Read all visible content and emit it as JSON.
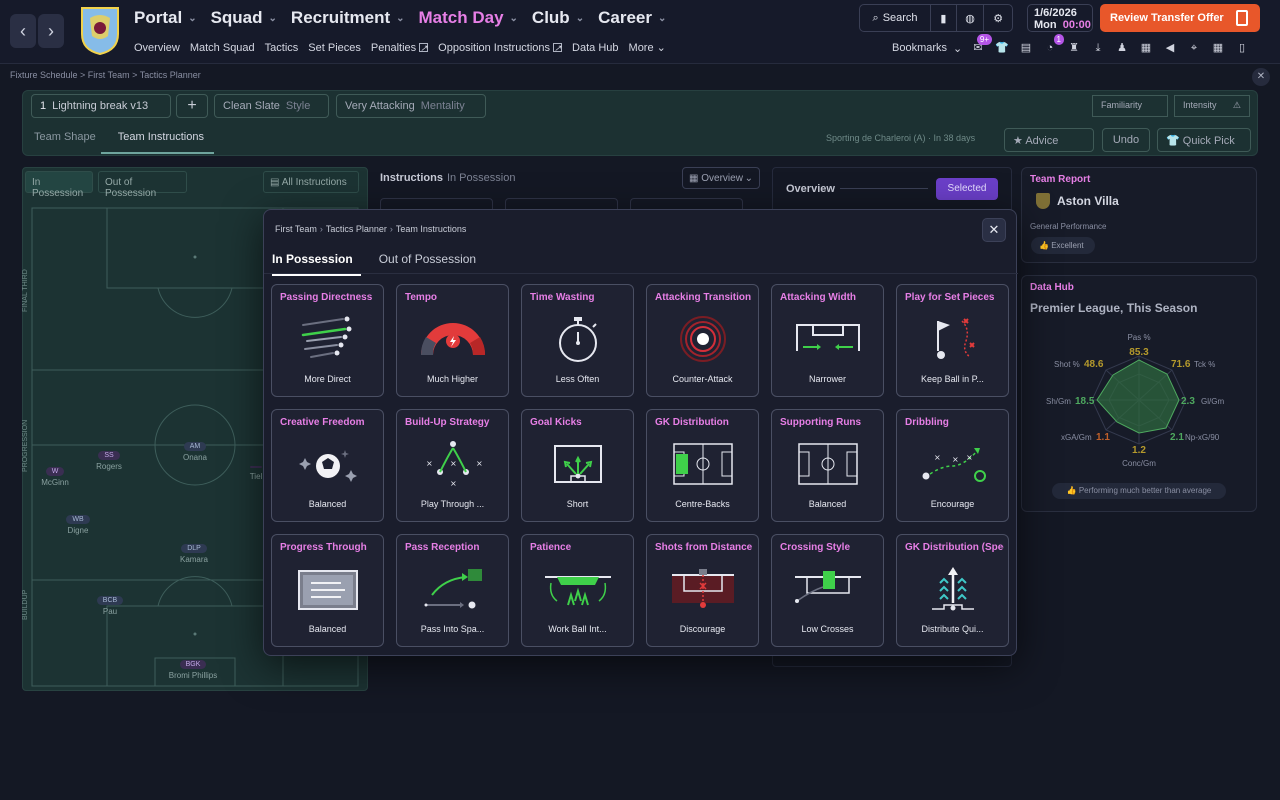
{
  "header": {
    "main_menu": [
      {
        "label": "Portal",
        "active": false
      },
      {
        "label": "Squad",
        "active": false
      },
      {
        "label": "Recruitment",
        "active": false
      },
      {
        "label": "Match Day",
        "active": true
      },
      {
        "label": "Club",
        "active": false
      },
      {
        "label": "Career",
        "active": false
      }
    ],
    "sub_menu": [
      "Overview",
      "Match Squad",
      "Tactics",
      "Set Pieces",
      "Penalties",
      "Opposition Instructions",
      "Data Hub",
      "More"
    ],
    "search_label": "Search",
    "date": "1/6/2026",
    "day": "Mon",
    "time": "00:00",
    "transfer_label": "Review Transfer Offer",
    "bookmarks_label": "Bookmarks",
    "badges": {
      "first": "9+",
      "second": "1"
    },
    "accent": "#e77fe6",
    "transfer_color": "#e8572a"
  },
  "breadcrumb": "Fixture Schedule  >  First Team  >  Tactics Planner",
  "planner": {
    "tactic_name": "Lightning break v13",
    "tactic_number": "1",
    "style": {
      "value": "Clean Slate",
      "label": "Style"
    },
    "mentality": {
      "value": "Very Attacking",
      "label": "Mentality"
    },
    "familiarity_label": "Familiarity",
    "intensity_label": "Intensity",
    "tabs": [
      "Team Shape",
      "Team Instructions"
    ],
    "fixture_note": "Sporting de Charleroi (A)  ·  In 38 days",
    "advice_label": "Advice",
    "undo_label": "Undo",
    "quick_pick_label": "Quick Pick"
  },
  "pitch": {
    "tab_in": "In Possession",
    "tab_out": "Out of Possession",
    "all_instructions": "All Instructions",
    "zones": [
      "FINAL THIRD",
      "PROGRESSION",
      "BUILDUP"
    ],
    "players": [
      {
        "role": "W",
        "name": "McGinn"
      },
      {
        "role": "SS",
        "name": "Rogers"
      },
      {
        "role": "AM",
        "name": "Onana"
      },
      {
        "role": "",
        "name": "Tiel"
      },
      {
        "role": "WB",
        "name": "Digne"
      },
      {
        "role": "DLP",
        "name": "Kamara"
      },
      {
        "role": "BCB",
        "name": "Pau"
      },
      {
        "role": "BGK",
        "name": "Bromi Phillips"
      }
    ]
  },
  "instructions": {
    "title": "Instructions",
    "sub": "In Possession",
    "view": "Overview"
  },
  "overview": {
    "label": "Overview",
    "selected_label": "Selected"
  },
  "team_report": {
    "title": "Team Report",
    "team": "Aston Villa",
    "perf_label": "General Performance",
    "perf_value": "Excellent"
  },
  "data_hub": {
    "title": "Data Hub",
    "subtitle": "Premier League, This Season",
    "stats": [
      {
        "label": "Pas %",
        "value": "85.3"
      },
      {
        "label": "Tck %",
        "value": "71.6"
      },
      {
        "label": "Gl/Gm",
        "value": "2.3"
      },
      {
        "label": "Np-xG/90",
        "value": "2.1"
      },
      {
        "label": "Conc/Gm",
        "value": "1.2"
      },
      {
        "label": "xGA/Gm",
        "value": "1.1"
      },
      {
        "label": "Sh/Gm",
        "value": "18.5"
      },
      {
        "label": "Shot %",
        "value": "48.6"
      }
    ],
    "footer": "Performing much better than average"
  },
  "modal": {
    "breadcrumb": [
      "First Team",
      "Tactics Planner",
      "Team Instructions"
    ],
    "close_label": "✕",
    "tabs": [
      {
        "label": "In Possession",
        "active": true
      },
      {
        "label": "Out of Possession",
        "active": false
      }
    ],
    "cards": [
      {
        "name": "Passing Directness",
        "value": "More Direct",
        "icon": "passing-directness-icon"
      },
      {
        "name": "Tempo",
        "value": "Much Higher",
        "icon": "tempo-gauge-icon"
      },
      {
        "name": "Time Wasting",
        "value": "Less Often",
        "icon": "stopwatch-icon"
      },
      {
        "name": "Attacking Transition",
        "value": "Counter-Attack",
        "icon": "transition-target-icon"
      },
      {
        "name": "Attacking Width",
        "value": "Narrower",
        "icon": "width-arrows-icon"
      },
      {
        "name": "Play for Set Pieces",
        "value": "Keep Ball in P...",
        "icon": "corner-flag-icon"
      },
      {
        "name": "Creative Freedom",
        "value": "Balanced",
        "icon": "sparkle-ball-icon"
      },
      {
        "name": "Build-Up Strategy",
        "value": "Play Through ...",
        "icon": "build-up-icon"
      },
      {
        "name": "Goal Kicks",
        "value": "Short",
        "icon": "goal-kick-icon"
      },
      {
        "name": "GK Distribution",
        "value": "Centre-Backs",
        "icon": "gk-distribution-icon"
      },
      {
        "name": "Supporting Runs",
        "value": "Balanced",
        "icon": "supporting-runs-icon"
      },
      {
        "name": "Dribbling",
        "value": "Encourage",
        "icon": "dribbling-icon"
      },
      {
        "name": "Progress Through",
        "value": "Balanced",
        "icon": "progress-through-icon"
      },
      {
        "name": "Pass Reception",
        "value": "Pass Into Spa...",
        "icon": "pass-reception-icon"
      },
      {
        "name": "Patience",
        "value": "Work Ball Int...",
        "icon": "patience-icon"
      },
      {
        "name": "Shots from Distance",
        "value": "Discourage",
        "icon": "shots-distance-icon"
      },
      {
        "name": "Crossing Style",
        "value": "Low Crosses",
        "icon": "crossing-icon"
      },
      {
        "name": "GK Distribution (Speed",
        "value": "Distribute Qui...",
        "icon": "gk-speed-icon"
      }
    ]
  }
}
